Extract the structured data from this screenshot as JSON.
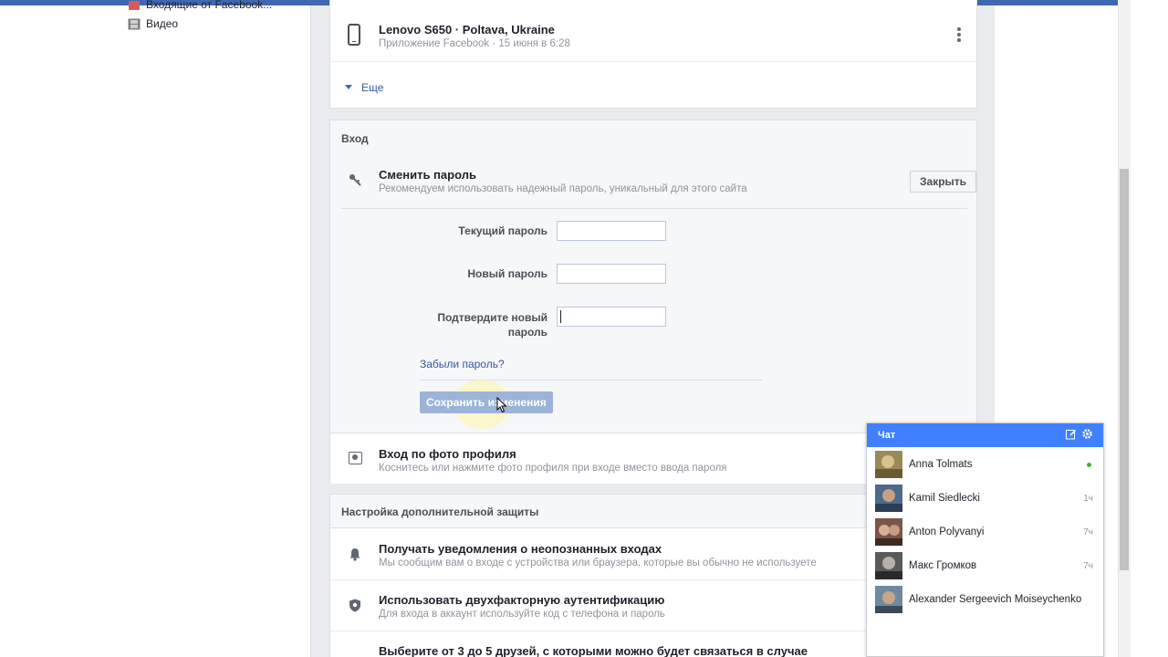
{
  "colors": {
    "brand_blue": "#4267b2",
    "chat_header": "#4080ff",
    "link": "#365899",
    "online": "#42b72a",
    "save_disabled": "#9cb4d8"
  },
  "left_nav": {
    "items": [
      {
        "label": "Входящие от Facebook...",
        "icon": "inbox-icon"
      },
      {
        "label": "Видео",
        "icon": "film-icon"
      }
    ]
  },
  "device": {
    "icon": "phone-icon",
    "title": "Lenovo S650 · Poltava, Ukraine",
    "subtitle": "Приложение Facebook · 15 июня в 6:28"
  },
  "more": {
    "label": "Еще"
  },
  "login": {
    "section_title": "Вход",
    "change_password": {
      "icon": "key-icon",
      "title": "Сменить пароль",
      "subtitle": "Рекомендуем использовать надежный пароль, уникальный для этого сайта",
      "close_label": "Закрыть"
    },
    "fields": {
      "current": {
        "label": "Текущий пароль",
        "value": ""
      },
      "new": {
        "label": "Новый пароль",
        "value": ""
      },
      "confirm": {
        "label": "Подтвердите новый пароль",
        "value": ""
      }
    },
    "forgot_label": "Забыли пароль?",
    "save_label": "Сохранить изменения",
    "profile_photo": {
      "icon": "profile-photo-icon",
      "title": "Вход по фото профиля",
      "subtitle": "Коснитесь или нажмите фото профиля при входе вместо ввода пароля"
    }
  },
  "security": {
    "section_title": "Настройка дополнительной защиты",
    "rows": [
      {
        "icon": "bell-icon",
        "title": "Получать уведомления о неопознанных входах",
        "subtitle": "Мы сообщим вам о входе с устройства или браузера, которые вы обычно не используете"
      },
      {
        "icon": "shield-icon",
        "title": "Использовать двухфакторную аутентификацию",
        "subtitle": "Для входа в аккаунт используйте код с телефона и пароль"
      },
      {
        "icon": "friends-icon",
        "title": "Выберите от 3 до 5 друзей, с которыми можно будет связаться в случае",
        "subtitle": ""
      }
    ]
  },
  "chat": {
    "title": "Чат",
    "contacts": [
      {
        "name": "Anna Tolmats",
        "status": "online",
        "time": ""
      },
      {
        "name": "Kamil Siedlecki",
        "status": "away",
        "time": "1ч"
      },
      {
        "name": "Anton Polyvanyi",
        "status": "away",
        "time": "7ч"
      },
      {
        "name": "Макс Громков",
        "status": "away",
        "time": "7ч"
      },
      {
        "name": "Alexander Sergeevich Moiseychenko",
        "status": "offline",
        "time": ""
      }
    ]
  }
}
